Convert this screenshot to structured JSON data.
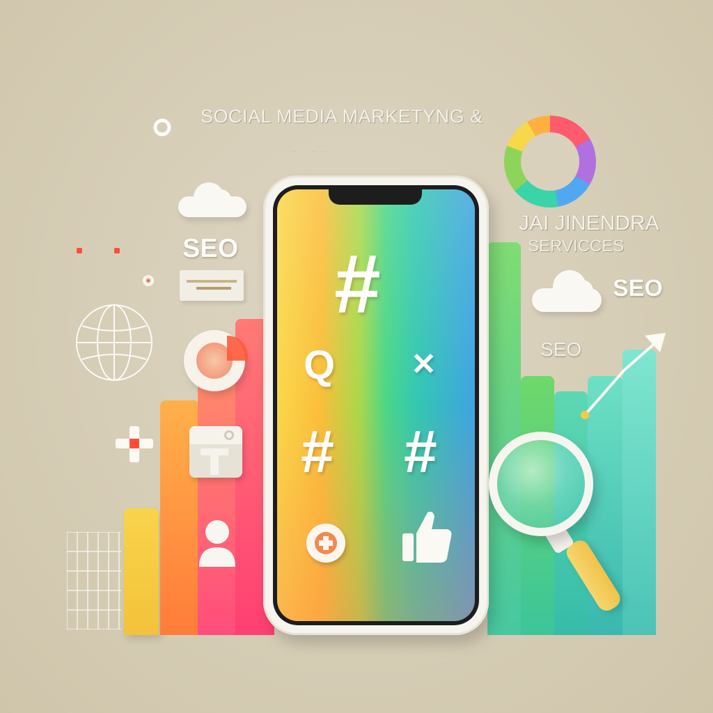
{
  "headline": "SOCIAL MEDIA MARKETYNG &",
  "brand": {
    "line1": "JAI JINENDRA",
    "line2": "SERVICCES"
  },
  "seo_labels": {
    "left": "SEO",
    "right": "SEO",
    "middle": "SEO"
  },
  "phone_icons": [
    {
      "name": "hashtag-icon",
      "glyph": "#"
    },
    {
      "name": "search-q-icon",
      "glyph": "Q"
    },
    {
      "name": "sparkle-icon",
      "glyph": "✕"
    },
    {
      "name": "hashtag-icon-2",
      "glyph": "#"
    },
    {
      "name": "hashtag-icon-3",
      "glyph": "#"
    },
    {
      "name": "add-circle-icon",
      "glyph": "✛"
    },
    {
      "name": "thumbs-up-icon",
      "glyph": "👍"
    }
  ],
  "colors": {
    "background": "#d6cdb6",
    "yellow": "#f7d14a",
    "orange": "#ff8a3c",
    "pink": "#ff4f80",
    "green": "#6fd86a",
    "teal": "#3cc7a8",
    "blue": "#3ea3e2"
  }
}
